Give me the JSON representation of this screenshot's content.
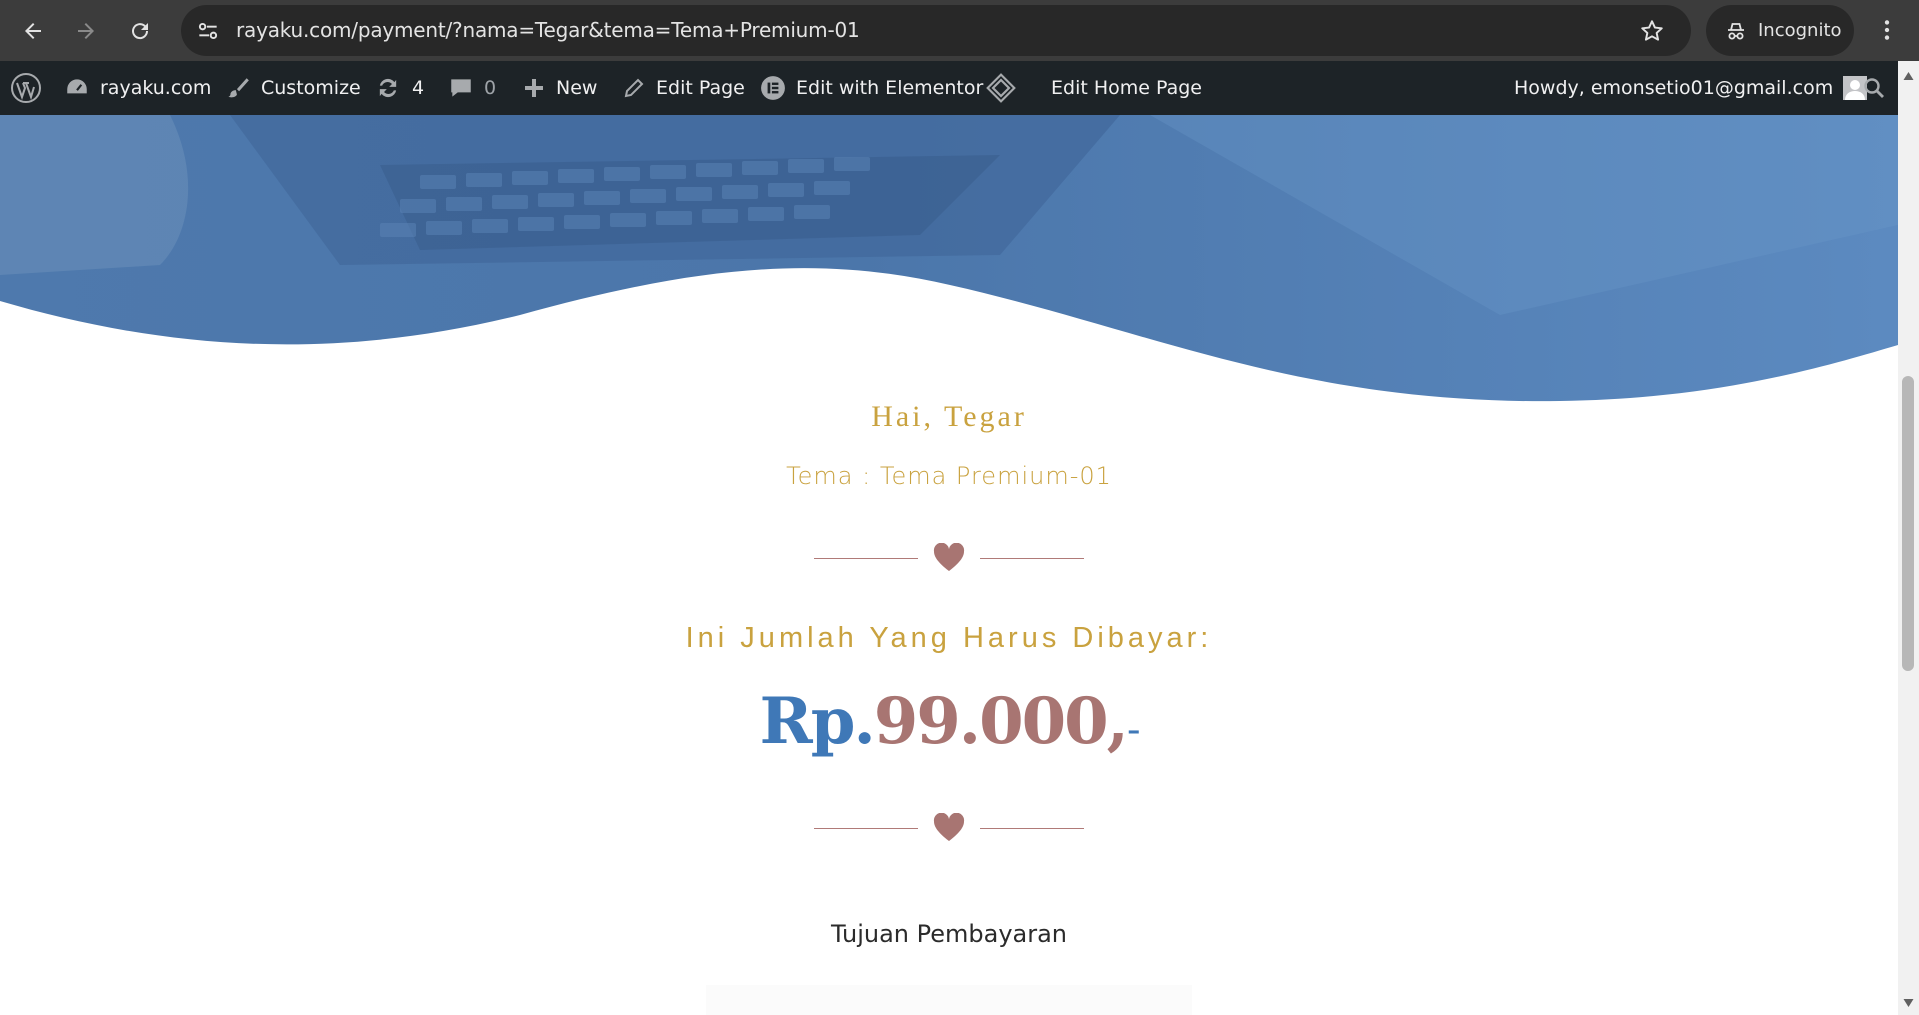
{
  "browser": {
    "url": "rayaku.com/payment/?nama=Tegar&tema=Tema+Premium-01",
    "incognito_label": "Incognito"
  },
  "adminbar": {
    "site": "rayaku.com",
    "customize": "Customize",
    "updates_count": "4",
    "comments_count": "0",
    "new": "New",
    "edit_page": "Edit Page",
    "edit_elementor": "Edit with Elementor",
    "edit_home": "Edit Home Page",
    "howdy": "Howdy, emonsetio01@gmail.com"
  },
  "page": {
    "greeting": "Hai, Tegar",
    "tema": "Tema : Tema Premium-01",
    "pay_label": "Ini Jumlah Yang Harus Dibayar:",
    "amount_rp": "Rp.",
    "amount_value": "99.000,",
    "amount_suffix": "-",
    "tujuan": "Tujuan Pembayaran"
  },
  "colors": {
    "accent_gold": "#c9a23f",
    "accent_blue": "#3f78b7",
    "accent_rose": "#a87572",
    "hero_blue": "#5b8ac0"
  }
}
